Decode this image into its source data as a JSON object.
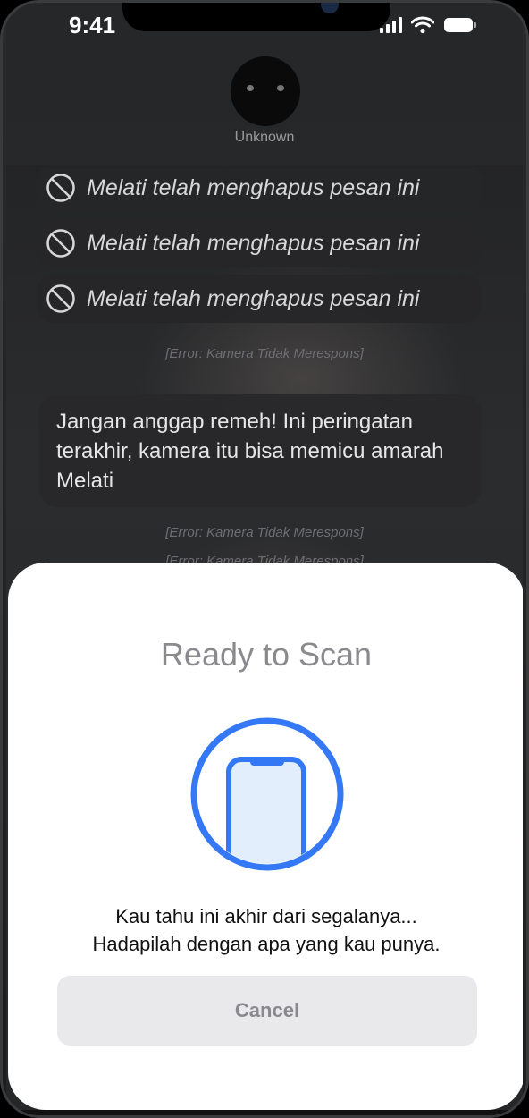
{
  "status_bar": {
    "time": "9:41"
  },
  "header": {
    "contact_name": "Unknown"
  },
  "messages": {
    "deleted": [
      "Melati telah menghapus pesan ini",
      "Melati telah menghapus pesan ini",
      "Melati telah menghapus pesan ini"
    ],
    "error_1": "[Error: Kamera Tidak Merespons]",
    "bubble_text": "Jangan anggap remeh! Ini peringatan terakhir, kamera itu bisa memicu amarah Melati",
    "error_2": "[Error: Kamera Tidak Merespons]",
    "error_3": "[Error: Kamera Tidak Merespons]"
  },
  "sheet": {
    "title": "Ready to Scan",
    "message_line1": "Kau tahu ini akhir dari segalanya...",
    "message_line2": "Hadapilah dengan apa yang kau punya.",
    "cancel_label": "Cancel",
    "accent_color": "#3478f6",
    "icon": "phone-scan-icon"
  }
}
